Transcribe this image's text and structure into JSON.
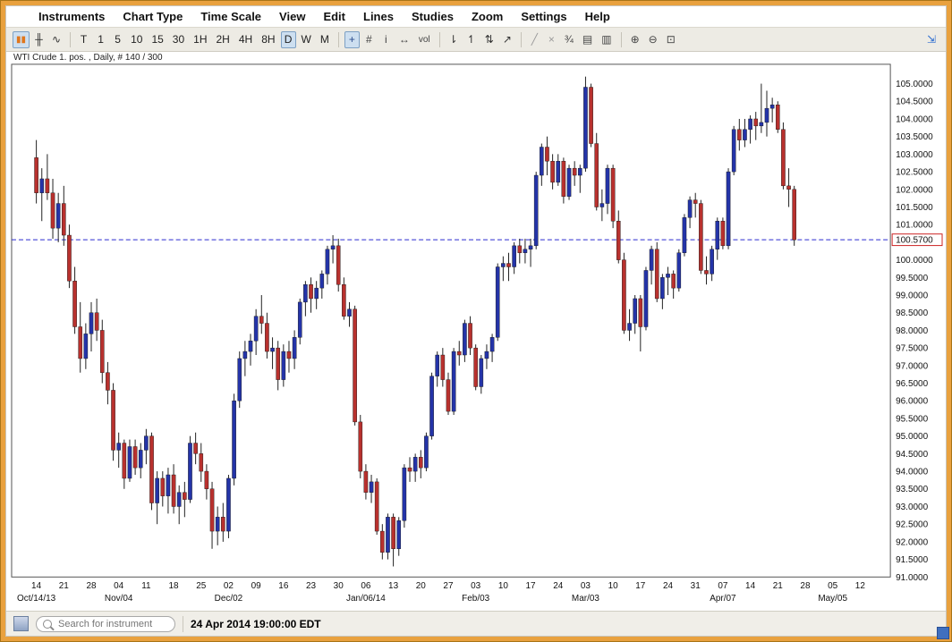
{
  "window": {
    "border_color": "#e9a13e"
  },
  "menu_bar": {
    "items": [
      "Instruments",
      "Chart Type",
      "Time Scale",
      "View",
      "Edit",
      "Lines",
      "Studies",
      "Zoom",
      "Settings",
      "Help"
    ]
  },
  "toolbar": {
    "chart_type_group": [
      {
        "name": "candlestick-chart-icon",
        "glyph": "▮▮",
        "active": true,
        "color": "#e0761c"
      },
      {
        "name": "ohlc-bars-icon",
        "glyph": "╫",
        "active": false,
        "color": "#333333"
      },
      {
        "name": "line-chart-icon",
        "glyph": "∿",
        "active": false,
        "color": "#333333"
      }
    ],
    "timeframes": {
      "options": [
        "T",
        "1",
        "5",
        "10",
        "15",
        "30",
        "1H",
        "2H",
        "4H",
        "8H",
        "D",
        "W",
        "M"
      ],
      "selected": "D"
    },
    "tool_group": [
      {
        "name": "crosshair-icon",
        "glyph": "+",
        "active": true,
        "color": "#2a4b8d"
      },
      {
        "name": "grid-icon",
        "glyph": "#",
        "active": false,
        "color": "#444444"
      },
      {
        "name": "info-icon",
        "glyph": "i",
        "active": false,
        "color": "#444444"
      },
      {
        "name": "horizontal-scale-icon",
        "glyph": "↔",
        "active": false,
        "color": "#444444"
      },
      {
        "name": "volume-icon",
        "glyph": "vol",
        "active": false,
        "color": "#444444"
      }
    ],
    "marker_group": [
      {
        "name": "cursor-down-icon",
        "glyph": "⇂",
        "active": false,
        "color": "#333333"
      },
      {
        "name": "cursor-up-icon",
        "glyph": "↿",
        "active": false,
        "color": "#333333"
      },
      {
        "name": "compare-icon",
        "glyph": "⇅",
        "active": false,
        "color": "#333333"
      },
      {
        "name": "trend-arrow-icon",
        "glyph": "↗",
        "active": false,
        "color": "#333333"
      }
    ],
    "drawing_group": [
      {
        "name": "trendline-icon",
        "glyph": "╱",
        "active": false,
        "color": "#9a9a9a"
      },
      {
        "name": "delete-drawing-icon",
        "glyph": "×",
        "active": false,
        "color": "#9a9a9a"
      },
      {
        "name": "fraction-display-icon",
        "glyph": "¾",
        "active": false,
        "color": "#444444"
      }
    ],
    "print_group": [
      {
        "name": "print-icon",
        "glyph": "▤",
        "active": false,
        "color": "#444444"
      },
      {
        "name": "print-preview-icon",
        "glyph": "▥",
        "active": false,
        "color": "#444444"
      }
    ],
    "zoom_group": [
      {
        "name": "zoom-in-icon",
        "glyph": "⊕",
        "active": false,
        "color": "#444444"
      },
      {
        "name": "zoom-out-icon",
        "glyph": "⊖",
        "active": false,
        "color": "#444444"
      },
      {
        "name": "zoom-reset-icon",
        "glyph": "⊡",
        "active": false,
        "color": "#444444"
      }
    ],
    "expand_icon": {
      "name": "dock-arrow-icon",
      "glyph": "⇲",
      "active": false,
      "color": "#2a6bd0"
    }
  },
  "chart": {
    "title": "WTI Crude 1. pos. , Daily, # 140 / 300",
    "price_marker": {
      "label": "100.5700",
      "value": 100.57,
      "line_color": "#2a2ad0",
      "box_border": "#cc2222"
    }
  },
  "chart_data": {
    "type": "candlestick",
    "symbol": "WTI Crude 1. pos.",
    "interval": "Daily",
    "bar_count_label": "# 140 / 300",
    "last_price": 100.57,
    "up_color": "#2434a8",
    "down_color": "#b8312e",
    "wick_color": "#222222",
    "y_axis": {
      "min": 91.0,
      "max": 105.0,
      "step": 0.5,
      "decimals": 4
    },
    "view": {
      "y_max": 105.55,
      "y_min": 91.0,
      "total_slots": 160,
      "lead_slots": 4
    },
    "x_axis": {
      "week_ticks": [
        [
          0,
          "14"
        ],
        [
          5,
          "21"
        ],
        [
          10,
          "28"
        ],
        [
          15,
          "04"
        ],
        [
          20,
          "11"
        ],
        [
          25,
          "18"
        ],
        [
          30,
          "25"
        ],
        [
          35,
          "02"
        ],
        [
          40,
          "09"
        ],
        [
          45,
          "16"
        ],
        [
          50,
          "23"
        ],
        [
          55,
          "30"
        ],
        [
          60,
          "06"
        ],
        [
          65,
          "13"
        ],
        [
          70,
          "20"
        ],
        [
          75,
          "27"
        ],
        [
          80,
          "03"
        ],
        [
          85,
          "10"
        ],
        [
          90,
          "17"
        ],
        [
          95,
          "24"
        ],
        [
          100,
          "03"
        ],
        [
          105,
          "10"
        ],
        [
          110,
          "17"
        ],
        [
          115,
          "24"
        ],
        [
          120,
          "31"
        ],
        [
          125,
          "07"
        ],
        [
          130,
          "14"
        ],
        [
          135,
          "21"
        ],
        [
          140,
          "28"
        ],
        [
          145,
          "05"
        ],
        [
          150,
          "12"
        ]
      ],
      "month_ticks": [
        [
          0,
          "Oct/14/13"
        ],
        [
          15,
          "Nov/04"
        ],
        [
          35,
          "Dec/02"
        ],
        [
          60,
          "Jan/06/14"
        ],
        [
          80,
          "Feb/03"
        ],
        [
          100,
          "Mar/03"
        ],
        [
          125,
          "Apr/07"
        ],
        [
          145,
          "May/05"
        ]
      ]
    },
    "candles": [
      [
        102.9,
        103.4,
        101.6,
        101.9
      ],
      [
        101.9,
        102.6,
        101.1,
        102.3
      ],
      [
        102.3,
        103.0,
        101.7,
        101.9
      ],
      [
        101.9,
        102.3,
        100.6,
        100.9
      ],
      [
        100.9,
        101.9,
        100.5,
        101.6
      ],
      [
        101.6,
        102.1,
        100.4,
        100.7
      ],
      [
        100.7,
        101.0,
        99.2,
        99.4
      ],
      [
        99.4,
        99.8,
        97.9,
        98.1
      ],
      [
        98.1,
        98.8,
        96.8,
        97.2
      ],
      [
        97.2,
        98.2,
        96.9,
        97.9
      ],
      [
        97.9,
        98.8,
        97.4,
        98.5
      ],
      [
        98.5,
        98.9,
        97.7,
        98.0
      ],
      [
        98.0,
        98.3,
        96.5,
        96.8
      ],
      [
        96.8,
        97.1,
        95.9,
        96.3
      ],
      [
        96.3,
        96.5,
        94.3,
        94.6
      ],
      [
        94.6,
        95.1,
        94.1,
        94.8
      ],
      [
        94.8,
        94.9,
        93.5,
        93.8
      ],
      [
        93.8,
        94.9,
        93.7,
        94.7
      ],
      [
        94.7,
        94.9,
        93.9,
        94.1
      ],
      [
        94.1,
        94.8,
        93.8,
        94.6
      ],
      [
        94.6,
        95.2,
        94.2,
        95.0
      ],
      [
        95.0,
        95.1,
        92.9,
        93.1
      ],
      [
        93.1,
        94.0,
        92.5,
        93.8
      ],
      [
        93.8,
        94.0,
        93.0,
        93.3
      ],
      [
        93.3,
        94.1,
        92.8,
        93.9
      ],
      [
        93.9,
        94.2,
        92.8,
        93.0
      ],
      [
        93.0,
        93.6,
        92.5,
        93.4
      ],
      [
        93.4,
        93.7,
        92.7,
        93.2
      ],
      [
        93.2,
        95.0,
        93.1,
        94.8
      ],
      [
        94.8,
        95.1,
        94.2,
        94.5
      ],
      [
        94.5,
        94.8,
        93.7,
        94.0
      ],
      [
        94.0,
        94.2,
        93.2,
        93.5
      ],
      [
        93.5,
        93.7,
        91.8,
        92.3
      ],
      [
        92.3,
        93.0,
        91.9,
        92.7
      ],
      [
        92.7,
        93.1,
        92.0,
        92.3
      ],
      [
        92.3,
        93.9,
        92.1,
        93.8
      ],
      [
        93.8,
        96.2,
        93.6,
        96.0
      ],
      [
        96.0,
        97.4,
        95.8,
        97.2
      ],
      [
        97.2,
        97.7,
        96.7,
        97.4
      ],
      [
        97.4,
        97.9,
        97.0,
        97.7
      ],
      [
        97.7,
        98.6,
        97.3,
        98.4
      ],
      [
        98.4,
        99.0,
        97.9,
        98.2
      ],
      [
        98.2,
        98.5,
        97.2,
        97.4
      ],
      [
        97.4,
        97.8,
        96.9,
        97.5
      ],
      [
        97.5,
        97.7,
        96.3,
        96.6
      ],
      [
        96.6,
        97.6,
        96.4,
        97.4
      ],
      [
        97.4,
        97.7,
        96.8,
        97.2
      ],
      [
        97.2,
        98.0,
        96.9,
        97.8
      ],
      [
        97.8,
        98.9,
        97.6,
        98.8
      ],
      [
        98.8,
        99.4,
        98.4,
        99.3
      ],
      [
        99.3,
        99.5,
        98.5,
        98.9
      ],
      [
        98.9,
        99.4,
        98.6,
        99.2
      ],
      [
        99.2,
        99.7,
        98.9,
        99.6
      ],
      [
        99.6,
        100.4,
        99.3,
        100.3
      ],
      [
        100.3,
        100.7,
        99.9,
        100.4
      ],
      [
        100.4,
        100.6,
        99.1,
        99.3
      ],
      [
        99.3,
        99.5,
        98.3,
        98.4
      ],
      [
        98.4,
        98.8,
        98.1,
        98.6
      ],
      [
        98.6,
        98.7,
        95.3,
        95.4
      ],
      [
        95.4,
        95.6,
        93.8,
        94.0
      ],
      [
        94.0,
        94.2,
        93.2,
        93.4
      ],
      [
        93.4,
        93.9,
        93.1,
        93.7
      ],
      [
        93.7,
        93.8,
        92.2,
        92.3
      ],
      [
        92.3,
        92.5,
        91.5,
        91.7
      ],
      [
        91.7,
        92.8,
        91.5,
        92.7
      ],
      [
        92.7,
        92.8,
        91.3,
        91.8
      ],
      [
        91.8,
        92.7,
        91.6,
        92.6
      ],
      [
        92.6,
        94.2,
        92.4,
        94.1
      ],
      [
        94.1,
        94.4,
        93.7,
        94.0
      ],
      [
        94.0,
        94.5,
        93.7,
        94.4
      ],
      [
        94.4,
        94.6,
        93.8,
        94.1
      ],
      [
        94.1,
        95.1,
        94.0,
        95.0
      ],
      [
        95.0,
        96.8,
        94.9,
        96.7
      ],
      [
        96.7,
        97.4,
        96.4,
        97.3
      ],
      [
        97.3,
        97.5,
        96.4,
        96.6
      ],
      [
        96.6,
        96.8,
        95.6,
        95.7
      ],
      [
        95.7,
        97.5,
        95.6,
        97.4
      ],
      [
        97.4,
        97.7,
        97.0,
        97.3
      ],
      [
        97.3,
        98.3,
        97.1,
        98.2
      ],
      [
        98.2,
        98.4,
        97.3,
        97.5
      ],
      [
        97.5,
        97.6,
        96.3,
        96.4
      ],
      [
        96.4,
        97.3,
        96.2,
        97.2
      ],
      [
        97.2,
        97.6,
        96.9,
        97.4
      ],
      [
        97.4,
        97.9,
        97.1,
        97.8
      ],
      [
        97.8,
        99.9,
        97.7,
        99.8
      ],
      [
        99.8,
        100.1,
        99.4,
        99.9
      ],
      [
        99.9,
        100.2,
        99.4,
        99.8
      ],
      [
        99.8,
        100.5,
        99.6,
        100.4
      ],
      [
        100.4,
        100.6,
        99.9,
        100.2
      ],
      [
        100.2,
        100.6,
        99.9,
        100.3
      ],
      [
        100.3,
        100.6,
        99.8,
        100.4
      ],
      [
        100.4,
        102.5,
        100.3,
        102.4
      ],
      [
        102.4,
        103.3,
        102.1,
        103.2
      ],
      [
        103.2,
        103.5,
        102.4,
        102.8
      ],
      [
        102.8,
        103.0,
        102.0,
        102.2
      ],
      [
        102.2,
        103.0,
        102.1,
        102.8
      ],
      [
        102.8,
        102.9,
        101.6,
        101.8
      ],
      [
        101.8,
        102.7,
        101.7,
        102.6
      ],
      [
        102.6,
        102.8,
        102.1,
        102.4
      ],
      [
        102.4,
        102.7,
        101.9,
        102.6
      ],
      [
        102.6,
        105.2,
        102.5,
        104.9
      ],
      [
        104.9,
        105.0,
        103.2,
        103.3
      ],
      [
        103.3,
        103.6,
        101.4,
        101.5
      ],
      [
        101.5,
        102.0,
        101.1,
        101.6
      ],
      [
        101.6,
        102.7,
        101.3,
        102.6
      ],
      [
        102.6,
        102.7,
        100.9,
        101.1
      ],
      [
        101.1,
        101.4,
        99.9,
        100.0
      ],
      [
        100.0,
        100.2,
        97.9,
        98.0
      ],
      [
        98.0,
        98.6,
        97.7,
        98.2
      ],
      [
        98.2,
        99.0,
        97.9,
        98.9
      ],
      [
        98.9,
        99.0,
        97.4,
        98.1
      ],
      [
        98.1,
        99.8,
        98.0,
        99.7
      ],
      [
        99.7,
        100.4,
        99.3,
        100.3
      ],
      [
        100.3,
        100.5,
        98.8,
        98.9
      ],
      [
        98.9,
        99.6,
        98.6,
        99.5
      ],
      [
        99.5,
        99.8,
        99.0,
        99.6
      ],
      [
        99.6,
        99.7,
        98.9,
        99.2
      ],
      [
        99.2,
        100.3,
        99.1,
        100.2
      ],
      [
        100.2,
        101.3,
        100.1,
        101.2
      ],
      [
        101.2,
        101.8,
        100.9,
        101.7
      ],
      [
        101.7,
        101.9,
        101.2,
        101.6
      ],
      [
        101.6,
        101.7,
        99.6,
        99.7
      ],
      [
        99.7,
        100.1,
        99.3,
        99.6
      ],
      [
        99.6,
        100.4,
        99.4,
        100.3
      ],
      [
        100.3,
        101.2,
        100.0,
        101.1
      ],
      [
        101.1,
        101.2,
        100.3,
        100.4
      ],
      [
        100.4,
        102.6,
        100.3,
        102.5
      ],
      [
        102.5,
        103.8,
        102.4,
        103.7
      ],
      [
        103.7,
        104.0,
        103.1,
        103.4
      ],
      [
        103.4,
        104.0,
        103.2,
        103.7
      ],
      [
        103.7,
        104.1,
        103.3,
        104.0
      ],
      [
        104.0,
        104.2,
        103.4,
        103.8
      ],
      [
        103.8,
        105.0,
        103.6,
        103.9
      ],
      [
        103.9,
        104.8,
        103.5,
        104.3
      ],
      [
        104.3,
        104.6,
        103.9,
        104.4
      ],
      [
        104.4,
        104.5,
        103.6,
        103.7
      ],
      [
        103.7,
        103.9,
        102.0,
        102.1
      ],
      [
        102.1,
        102.6,
        101.5,
        102.0
      ],
      [
        102.0,
        102.1,
        100.4,
        100.57
      ]
    ]
  },
  "status_bar": {
    "search": {
      "placeholder": "Search for instrument"
    },
    "timestamp": "24 Apr 2014 19:00:00 EDT"
  }
}
